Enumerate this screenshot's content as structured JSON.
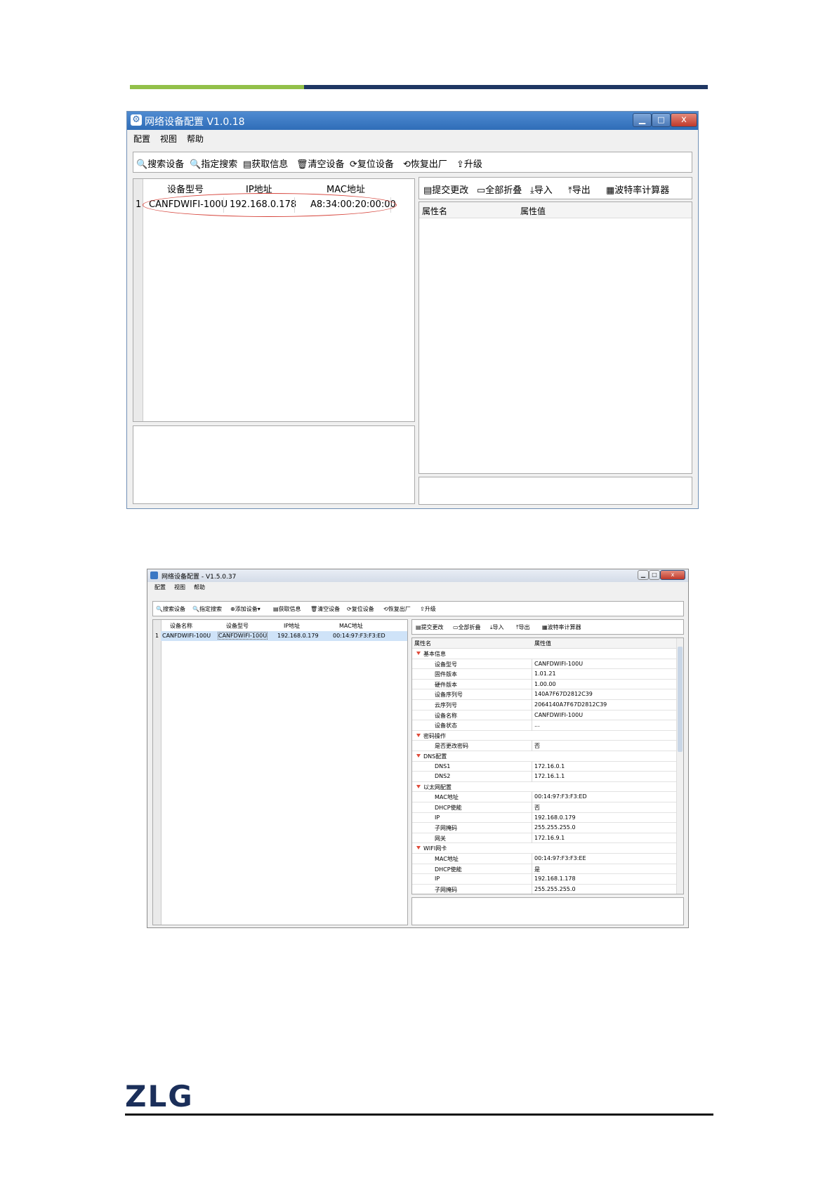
{
  "header_colors": {
    "green": "#92c04a",
    "navy": "#1f3763"
  },
  "window1": {
    "title": "网络设备配置 V1.0.18",
    "menu": [
      "配置",
      "视图",
      "帮助"
    ],
    "toolbar": [
      {
        "label": "搜索设备",
        "icon": "search-icon"
      },
      {
        "label": "指定搜索",
        "icon": "target-search-icon"
      },
      {
        "label": "获取信息",
        "icon": "get-info-icon"
      },
      {
        "label": "清空设备",
        "icon": "trash-icon"
      },
      {
        "label": "复位设备",
        "icon": "refresh-icon"
      },
      {
        "label": "恢复出厂",
        "icon": "restore-icon"
      },
      {
        "label": "升级",
        "icon": "upgrade-icon"
      }
    ],
    "device_table": {
      "columns": [
        "设备型号",
        "IP地址",
        "MAC地址"
      ],
      "rows": [
        {
          "index": "1",
          "model": "CANFDWIFI-100U",
          "ip": "192.168.0.178",
          "mac": "A8:34:00:20:00:00"
        }
      ]
    },
    "prop_toolbar": [
      {
        "label": "提交更改",
        "icon": "submit-icon"
      },
      {
        "label": "全部折叠",
        "icon": "collapse-icon"
      },
      {
        "label": "导入",
        "icon": "import-icon"
      },
      {
        "label": "导出",
        "icon": "export-icon"
      },
      {
        "label": "波特率计算器",
        "icon": "calculator-icon"
      }
    ],
    "prop_columns": [
      "属性名",
      "属性值"
    ]
  },
  "window2": {
    "title": "网络设备配置 - V1.5.0.37",
    "menu": [
      "配置",
      "视图",
      "帮助"
    ],
    "toolbar": [
      {
        "label": "搜索设备",
        "icon": "search-icon"
      },
      {
        "label": "指定搜索",
        "icon": "target-search-icon"
      },
      {
        "label": "添加设备▾",
        "icon": "add-icon"
      },
      {
        "label": "获取信息",
        "icon": "get-info-icon"
      },
      {
        "label": "清空设备",
        "icon": "trash-icon"
      },
      {
        "label": "复位设备",
        "icon": "refresh-icon"
      },
      {
        "label": "恢复出厂",
        "icon": "restore-icon"
      },
      {
        "label": "升级",
        "icon": "upgrade-icon"
      }
    ],
    "device_table": {
      "columns": [
        "设备名称",
        "设备型号",
        "IP地址",
        "MAC地址"
      ],
      "rows": [
        {
          "index": "1",
          "name": "CANFDWIFI-100U",
          "model": "CANFDWIFI-100U",
          "ip": "192.168.0.179",
          "mac": "00:14:97:F3:F3:ED"
        }
      ]
    },
    "prop_toolbar": [
      {
        "label": "提交更改",
        "icon": "submit-icon"
      },
      {
        "label": "全部折叠",
        "icon": "collapse-icon"
      },
      {
        "label": "导入",
        "icon": "import-icon"
      },
      {
        "label": "导出",
        "icon": "export-icon"
      },
      {
        "label": "波特率计算器",
        "icon": "calculator-icon"
      }
    ],
    "prop_columns": [
      "属性名",
      "属性值"
    ],
    "properties": [
      {
        "type": "category",
        "name": "基本信息"
      },
      {
        "type": "item",
        "name": "设备型号",
        "value": "CANFDWIFI-100U"
      },
      {
        "type": "item",
        "name": "固件版本",
        "value": "1.01.21"
      },
      {
        "type": "item",
        "name": "硬件版本",
        "value": "1.00.00"
      },
      {
        "type": "item",
        "name": "设备序列号",
        "value": "140A7F67D2812C39"
      },
      {
        "type": "item",
        "name": "云序列号",
        "value": "2064140A7F67D2812C39"
      },
      {
        "type": "item",
        "name": "设备名称",
        "value": "CANFDWIFI-100U"
      },
      {
        "type": "item",
        "name": "设备状态",
        "value": "..."
      },
      {
        "type": "category",
        "name": "密码操作"
      },
      {
        "type": "item",
        "name": "是否更改密码",
        "value": "否"
      },
      {
        "type": "category",
        "name": "DNS配置"
      },
      {
        "type": "item",
        "name": "DNS1",
        "value": "172.16.0.1"
      },
      {
        "type": "item",
        "name": "DNS2",
        "value": "172.16.1.1"
      },
      {
        "type": "category",
        "name": "以太网配置"
      },
      {
        "type": "item",
        "name": "MAC地址",
        "value": "00:14:97:F3:F3:ED"
      },
      {
        "type": "item",
        "name": "DHCP使能",
        "value": "否"
      },
      {
        "type": "item",
        "name": "IP",
        "value": "192.168.0.179"
      },
      {
        "type": "item",
        "name": "子网掩码",
        "value": "255.255.255.0"
      },
      {
        "type": "item",
        "name": "网关",
        "value": "172.16.9.1"
      },
      {
        "type": "category",
        "name": "WIFI网卡"
      },
      {
        "type": "item",
        "name": "MAC地址",
        "value": "00:14:97:F3:F3:EE"
      },
      {
        "type": "item",
        "name": "DHCP使能",
        "value": "是"
      },
      {
        "type": "item",
        "name": "IP",
        "value": "192.168.1.178"
      },
      {
        "type": "item",
        "name": "子网掩码",
        "value": "255.255.255.0"
      }
    ]
  },
  "footer": {
    "logo": "ZLG"
  }
}
